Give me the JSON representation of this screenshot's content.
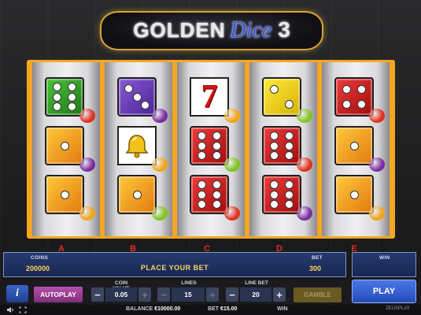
{
  "logo": {
    "word1": "GOLDEN",
    "word2": "Dice",
    "number": "3"
  },
  "reels": {
    "labels": [
      "A",
      "B",
      "C",
      "D",
      "E"
    ],
    "symbols": [
      [
        "die-green-6",
        "die-orange-1",
        "die-orange-1"
      ],
      [
        "die-purple-3",
        "bell",
        "die-orange-1"
      ],
      [
        "seven",
        "die-red-6",
        "die-red-6"
      ],
      [
        "die-yellow-2",
        "die-red-6",
        "die-red-6"
      ],
      [
        "die-red-4",
        "die-orange-1",
        "die-orange-1"
      ]
    ]
  },
  "info": {
    "coins_label": "COINS",
    "coins_value": "200000",
    "message": "PLACE YOUR BET",
    "bet_label": "BET",
    "bet_value": "300",
    "win_label": "WIN"
  },
  "controls": {
    "info_label": "i",
    "autoplay_label": "AUTOPLAY",
    "coin_value_label": "COIN VALUE",
    "coin_value": "0.05",
    "lines_label": "LINES",
    "lines_value": "15",
    "line_bet_label": "LINE BET",
    "line_bet_value": "20",
    "gamble_label": "GAMBLE",
    "play_label": "PLAY",
    "minus": "−",
    "plus": "+"
  },
  "footer": {
    "balance_label": "BALANCE",
    "balance_value": "€10000.00",
    "bet_label": "BET",
    "bet_value": "€15.00",
    "win_label": "WIN",
    "brand": "ZEUSPLAY"
  },
  "colors": {
    "frame": "#f5a623",
    "panel": "#182855",
    "accent_text": "#ffd35a",
    "reel_label": "#e0301e"
  }
}
